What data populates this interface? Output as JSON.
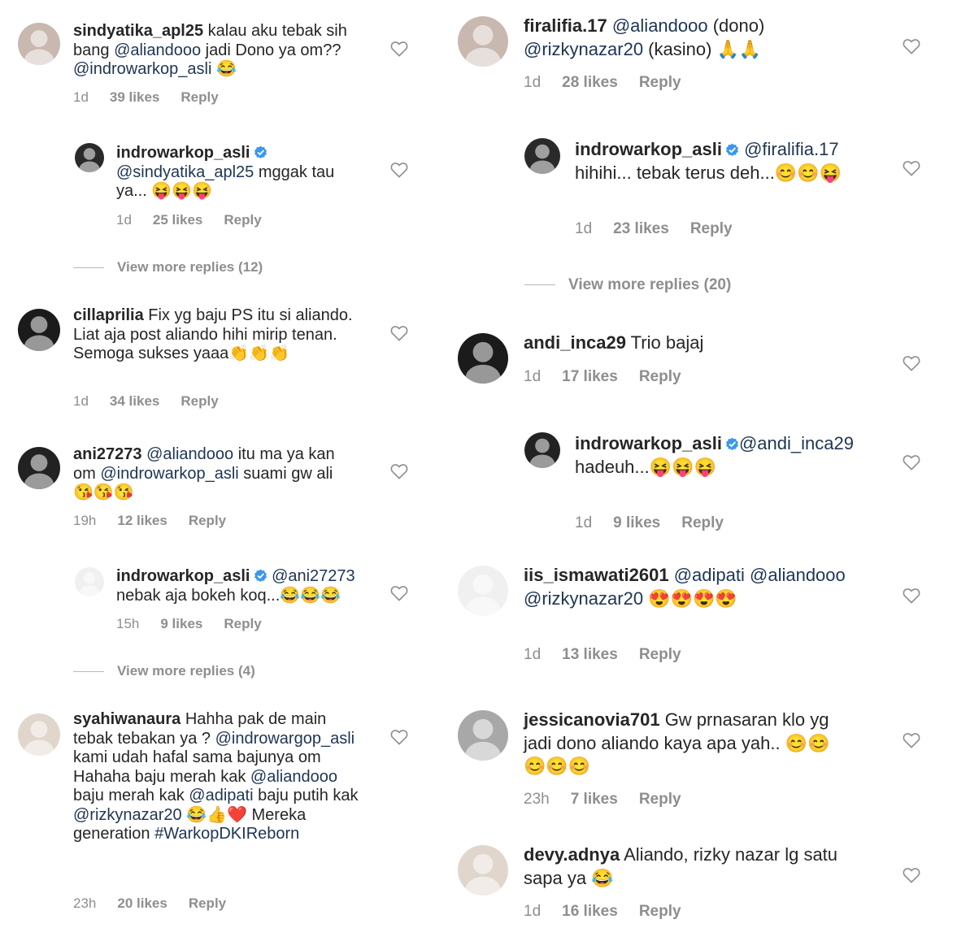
{
  "left": [
    {
      "user": "sindyatika_apl25",
      "parts": [
        {
          "t": " kalau aku tebak sih bang "
        },
        {
          "m": "@aliandooo"
        },
        {
          "t": "  jadi Dono ya om?? "
        },
        {
          "m": "@indrowarkop_asli"
        },
        {
          "t": " 😂"
        }
      ],
      "time": "1d",
      "likes": "39 likes",
      "reply": "Reply"
    },
    {
      "user": "indrowarkop_asli",
      "verified": true,
      "parts": [
        {
          "m": "@sindyatika_apl25"
        },
        {
          "t": " mggak tau ya... 😝😝😝"
        }
      ],
      "time": "1d",
      "likes": "25 likes",
      "reply": "Reply"
    },
    {
      "viewmore": "View more replies (12)"
    },
    {
      "user": "cillaprilia",
      "parts": [
        {
          "t": " Fix yg baju PS itu si aliando. Liat aja post aliando hihi mirip tenan. Semoga sukses yaaa👏👏👏"
        }
      ],
      "time": "1d",
      "likes": "34 likes",
      "reply": "Reply"
    },
    {
      "user": "ani27273",
      "parts": [
        {
          "t": " "
        },
        {
          "m": "@aliandooo"
        },
        {
          "t": " itu ma ya kan om "
        },
        {
          "m": "@indrowarkop_asli"
        },
        {
          "t": " suami gw ali 😘😘😘"
        }
      ],
      "time": "19h",
      "likes": "12 likes",
      "reply": "Reply"
    },
    {
      "user": "indrowarkop_asli",
      "verified": true,
      "parts": [
        {
          "t": " "
        },
        {
          "m": "@ani27273"
        },
        {
          "t": " nebak aja bokeh koq...😂😂😂"
        }
      ],
      "time": "15h",
      "likes": "9 likes",
      "reply": "Reply"
    },
    {
      "viewmore": "View more replies (4)"
    },
    {
      "user": "syahiwanaura",
      "parts": [
        {
          "t": " Hahha pak de main tebak tebakan ya ? "
        },
        {
          "m": "@indrowargop_asli"
        },
        {
          "t": " kami udah hafal sama bajunya om Hahaha baju merah kak "
        },
        {
          "m": "@aliandooo"
        },
        {
          "t": " baju merah kak "
        },
        {
          "m": "@adipati"
        },
        {
          "t": " baju putih kak "
        },
        {
          "m": "@rizkynazar20"
        },
        {
          "t": " 😂👍❤️ Mereka generation "
        },
        {
          "m": "#WarkopDKIReborn"
        }
      ],
      "time": "23h",
      "likes": "20 likes",
      "reply": "Reply"
    }
  ],
  "right": [
    {
      "user": "firalifia.17",
      "parts": [
        {
          "t": " "
        },
        {
          "m": "@aliandooo"
        },
        {
          "t": " (dono) "
        },
        {
          "m": "@rizkynazar20"
        },
        {
          "t": " (kasino) 🙏🙏"
        }
      ],
      "time": "1d",
      "likes": "28 likes",
      "reply": "Reply"
    },
    {
      "user": "indrowarkop_asli",
      "verified": true,
      "parts": [
        {
          "t": " "
        },
        {
          "m": "@firalifia.17"
        },
        {
          "t": " hihihi... tebak terus deh...😊😊😝"
        }
      ],
      "time": "1d",
      "likes": "23 likes",
      "reply": "Reply"
    },
    {
      "viewmore": "View more replies (20)"
    },
    {
      "user": "andi_inca29",
      "parts": [
        {
          "t": " Trio bajaj"
        }
      ],
      "time": "1d",
      "likes": "17 likes",
      "reply": "Reply"
    },
    {
      "user": "indrowarkop_asli",
      "verified": true,
      "parts": [
        {
          "m": "@andi_inca29"
        },
        {
          "t": " hadeuh...😝😝😝"
        }
      ],
      "time": "1d",
      "likes": "9 likes",
      "reply": "Reply"
    },
    {
      "user": "iis_ismawati2601",
      "parts": [
        {
          "t": " "
        },
        {
          "m": "@adipati"
        },
        {
          "t": " "
        },
        {
          "m": "@aliandooo"
        },
        {
          "t": " "
        },
        {
          "m": "@rizkynazar20"
        },
        {
          "t": " 😍😍😍😍"
        }
      ],
      "time": "1d",
      "likes": "13 likes",
      "reply": "Reply"
    },
    {
      "user": "jessicanovia701",
      "parts": [
        {
          "t": " Gw prnasaran klo yg jadi dono aliando kaya apa yah.. 😊😊😊😊😊"
        }
      ],
      "time": "23h",
      "likes": "7 likes",
      "reply": "Reply"
    },
    {
      "user": "devy.adnya",
      "parts": [
        {
          "t": " Aliando, rizky nazar lg satu sapa ya 😂"
        }
      ],
      "time": "1d",
      "likes": "16 likes",
      "reply": "Reply"
    }
  ],
  "colors": {
    "text": "#262626",
    "mention": "#1e3553",
    "meta": "#8e8e8e",
    "verified": "#3897f0"
  }
}
